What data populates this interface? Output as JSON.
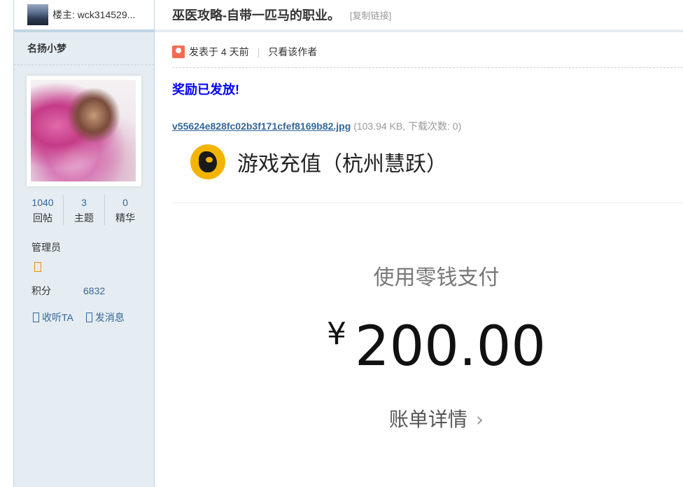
{
  "sidebar": {
    "op_label": "楼主: wck314529...",
    "username": "名扬小梦",
    "stats": [
      {
        "num": "1040",
        "label": "回帖"
      },
      {
        "num": "3",
        "label": "主题"
      },
      {
        "num": "0",
        "label": "精华"
      }
    ],
    "group": "管理员",
    "points_label": "积分",
    "points_value": "6832",
    "follow_label": "收听TA",
    "message_label": "发消息"
  },
  "post": {
    "title": "巫医攻略-自带一匹马的职业。",
    "copy_link": "[复制链接]",
    "posted": "发表于 4 天前",
    "separator": "|",
    "only_author": "只看该作者",
    "reward": "奖励已发放!",
    "attachment": {
      "filename": "v55624e828fc02b3f171cfef8169b82.jpg",
      "info": "(103.94 KB, 下载次数: 0)"
    },
    "screenshot": {
      "merchant": "游戏充值（杭州慧跃）",
      "pay_label": "使用零钱支付",
      "currency": "¥",
      "amount": "200.00",
      "bill_details": "账单详情",
      "chevron": "›"
    }
  },
  "colors": {
    "sidebar_bg": "#e5edf2",
    "border": "#c2d5e3",
    "link": "#336699",
    "reward": "#0000ff"
  }
}
